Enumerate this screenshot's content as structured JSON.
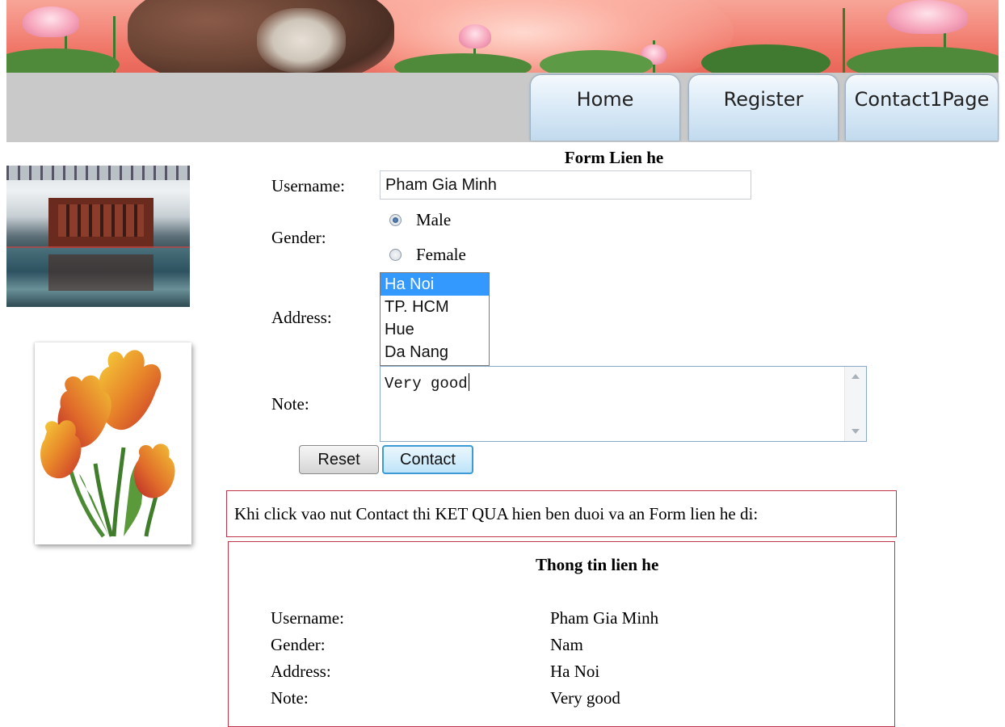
{
  "nav": {
    "tabs": [
      {
        "label": "Home"
      },
      {
        "label": "Register"
      },
      {
        "label": "Contact1Page"
      }
    ]
  },
  "form": {
    "title": "Form Lien he",
    "username_label": "Username:",
    "username_value": "Pham Gia Minh",
    "gender_label": "Gender:",
    "gender_options": [
      "Male",
      "Female"
    ],
    "gender_selected": "Male",
    "address_label": "Address:",
    "address_options": [
      "Ha Noi",
      "TP. HCM",
      "Hue",
      "Da Nang"
    ],
    "address_selected": "Ha Noi",
    "note_label": "Note:",
    "note_value": "Very good",
    "reset_label": "Reset",
    "contact_label": "Contact"
  },
  "hint": "Khi click vao nut Contact thi KET QUA hien ben duoi va an Form lien he di:",
  "result": {
    "title": "Thong tin lien he",
    "rows": [
      {
        "label": "Username:",
        "value": "Pham Gia Minh"
      },
      {
        "label": "Gender:",
        "value": "Nam"
      },
      {
        "label": "Address:",
        "value": "Ha Noi"
      },
      {
        "label": "Note:",
        "value": "Very good"
      }
    ]
  },
  "colors": {
    "navbar": "#c9c9c9",
    "selected_option": "#3399ff",
    "box_border": "#c0344a",
    "contact_button_border": "#3c9bd6"
  }
}
